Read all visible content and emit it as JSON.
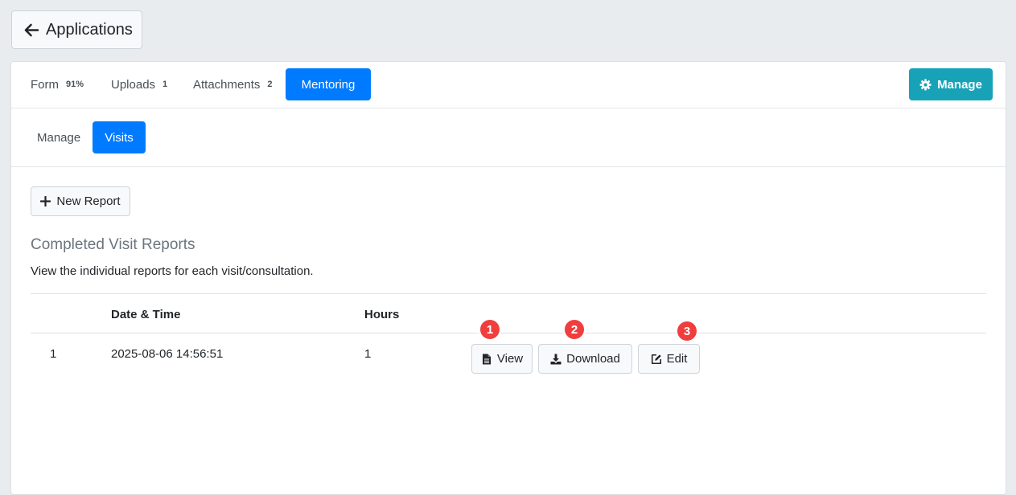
{
  "back_button": {
    "label": "Applications",
    "icon": "arrow-left-icon"
  },
  "tabs": [
    {
      "label": "Form",
      "badge": "91%"
    },
    {
      "label": "Uploads",
      "badge": "1"
    },
    {
      "label": "Attachments",
      "badge": "2"
    },
    {
      "label": "Mentoring",
      "badge": ""
    }
  ],
  "active_tab": "Mentoring",
  "manage_button": {
    "label": "Manage",
    "icon": "gear-icon"
  },
  "subtabs": [
    {
      "label": "Manage"
    },
    {
      "label": "Visits"
    }
  ],
  "active_subtab": "Visits",
  "new_report_button": {
    "label": "New Report",
    "icon": "plus-icon"
  },
  "section": {
    "title": "Completed Visit Reports",
    "description": "View the individual reports for each visit/consultation."
  },
  "table": {
    "columns": [
      "",
      "Date & Time",
      "Hours",
      ""
    ],
    "rows": [
      {
        "index": "1",
        "datetime": "2025-08-06 14:56:51",
        "hours": "1"
      }
    ],
    "actions": {
      "view": "View",
      "download": "Download",
      "edit": "Edit"
    }
  },
  "markers": [
    "1",
    "2",
    "3"
  ],
  "colors": {
    "primary": "#007bff",
    "info": "#17a2b8",
    "marker": "#f03e3e",
    "background": "#e9ecef"
  }
}
